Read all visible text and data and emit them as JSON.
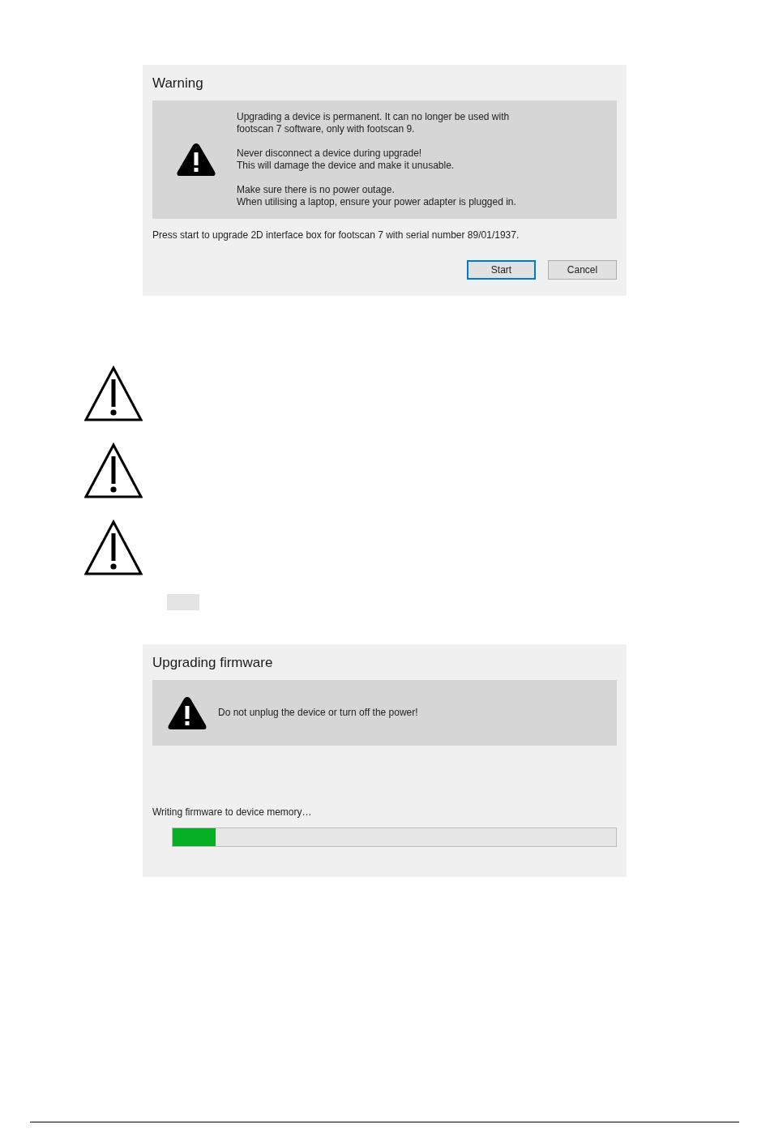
{
  "warning_dialog": {
    "title": "Warning",
    "messages": [
      {
        "lines": [
          "Upgrading a device is permanent. It can no longer be used with",
          "footscan 7 software, only with footscan 9."
        ]
      },
      {
        "lines": [
          "Never disconnect a device during upgrade!",
          "This will damage the device and make it unusable."
        ]
      },
      {
        "lines": [
          "Make sure there is no power outage.",
          "When utilising a laptop, ensure your power adapter is plugged in."
        ]
      }
    ],
    "prompt": "Press start to upgrade 2D interface box for footscan 7 with serial number 89/01/1937.",
    "buttons": [
      {
        "label": "Start",
        "selected": true
      },
      {
        "label": "Cancel",
        "selected": false
      }
    ]
  },
  "notices": [
    {
      "kind": "caution"
    },
    {
      "kind": "caution"
    },
    {
      "kind": "caution"
    }
  ],
  "progress_dialog": {
    "title": "Upgrading firmware",
    "message": "Do not unplug the device or turn off the power!",
    "status": "Writing firmware to device memory…",
    "progress": {
      "level": 0.097
    }
  }
}
